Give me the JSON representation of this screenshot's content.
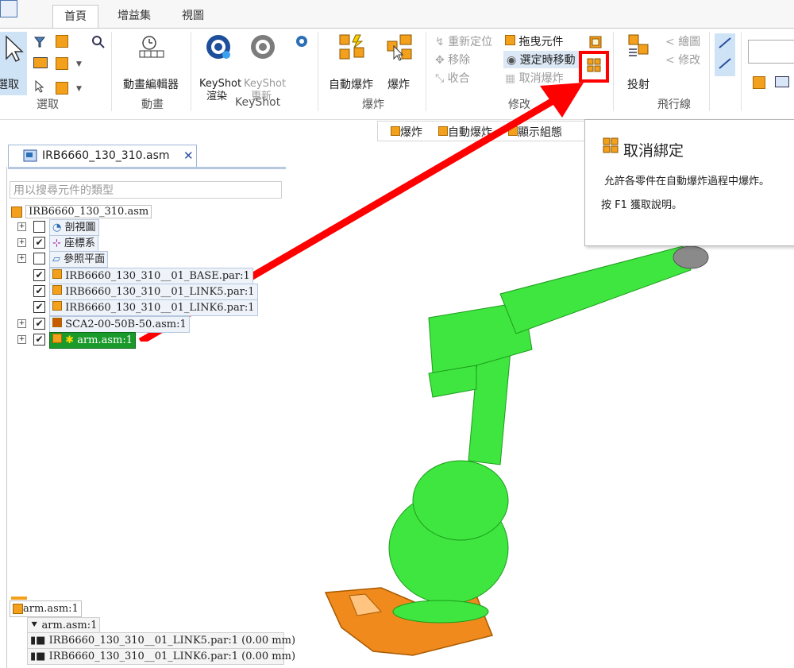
{
  "tabs": [
    "首頁",
    "增益集",
    "視圖"
  ],
  "ribbon": {
    "select": {
      "label": "選取",
      "group": "選取"
    },
    "anim": {
      "label": "動畫編輯器",
      "group": "動畫"
    },
    "keyshot": {
      "render_line1": "KeyShot",
      "render_line2": "渲染",
      "update_line1": "KeyShot",
      "update_line2": "更新",
      "group": "KeyShot"
    },
    "explode": {
      "auto": "自動爆炸",
      "manual": "爆炸",
      "group": "爆炸"
    },
    "modify": {
      "reposition": "重新定位",
      "move": "移除",
      "collapse": "收合",
      "drag": "拖曳元件",
      "move_on_select": "選定時移動",
      "cancel_explode": "取消爆炸",
      "group": "修改"
    },
    "flight": {
      "project": "投射",
      "draw": "繪圖",
      "edit": "修改",
      "group": "飛行線"
    }
  },
  "toolbar2": {
    "explode": "爆炸",
    "auto_explode": "自動爆炸",
    "show_config": "顯示組態"
  },
  "tooltip": {
    "title": "取消綁定",
    "desc": "允許各零件在自動爆炸過程中爆炸。",
    "help": "按 F1 獲取說明。"
  },
  "document": {
    "tab_title": "IRB6660_130_310.asm",
    "close": "✕"
  },
  "search": {
    "placeholder": "用以搜尋元件的類型"
  },
  "tree": {
    "root": "IRB6660_130_310.asm",
    "items": [
      {
        "label": "剖視圖",
        "checked": false,
        "expand": true
      },
      {
        "label": "座標系",
        "checked": true,
        "expand": true
      },
      {
        "label": "參照平面",
        "checked": false,
        "expand": true
      },
      {
        "label": "IRB6660_130_310__01_BASE.par:1",
        "checked": true,
        "expand": false
      },
      {
        "label": "IRB6660_130_310__01_LINK5.par:1",
        "checked": true,
        "expand": false
      },
      {
        "label": "IRB6660_130_310__01_LINK6.par:1",
        "checked": true,
        "expand": false
      },
      {
        "label": "SCA2-00-50B-50.asm:1",
        "checked": true,
        "expand": true
      },
      {
        "label": "arm.asm:1",
        "checked": true,
        "expand": true
      }
    ]
  },
  "bottom_panel": {
    "header": "arm.asm:1",
    "sub": "arm.asm:1",
    "rows": [
      "IRB6660_130_310__01_LINK5.par:1   (0.00 mm)",
      "IRB6660_130_310__01_LINK6.par:1   (0.00 mm)"
    ]
  },
  "colors": {
    "highlight": "#ff0000",
    "robot_green": "#3fe63f",
    "robot_orange": "#f08a1c",
    "selected_node": "#1a9a2a"
  }
}
